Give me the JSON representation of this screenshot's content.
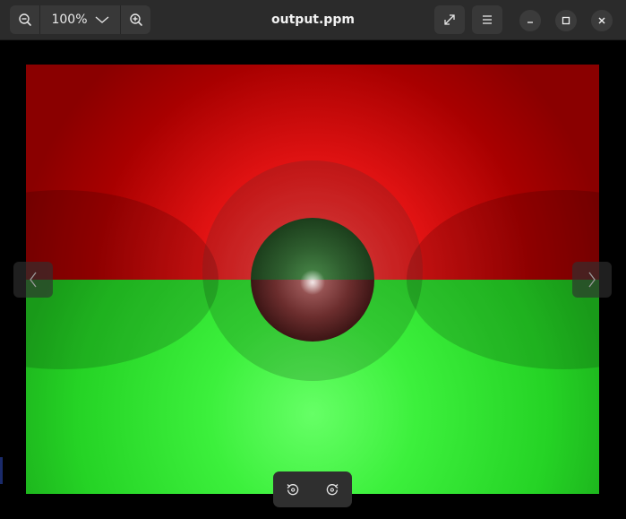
{
  "window": {
    "title": "output.ppm"
  },
  "toolbar": {
    "zoom_level": "100%",
    "zoom_out_icon": "zoom-out-icon",
    "zoom_in_icon": "zoom-in-icon",
    "zoom_menu_icon": "chevron-down-icon",
    "fullscreen_icon": "fullscreen-icon",
    "menu_icon": "hamburger-menu-icon",
    "minimize_icon": "minimize-icon",
    "maximize_icon": "maximize-icon",
    "close_icon": "close-icon"
  },
  "viewer": {
    "prev_icon": "chevron-left-icon",
    "next_icon": "chevron-right-icon",
    "rotate_left_icon": "rotate-left-icon",
    "rotate_right_icon": "rotate-right-icon"
  },
  "colors": {
    "sky_top": "#8a0000",
    "sky_horizon": "#ff3b3b",
    "ground_horizon": "#22e322",
    "ground_bottom": "#1fc41f",
    "header_bg": "#2b2b2b",
    "button_bg": "#383838"
  }
}
